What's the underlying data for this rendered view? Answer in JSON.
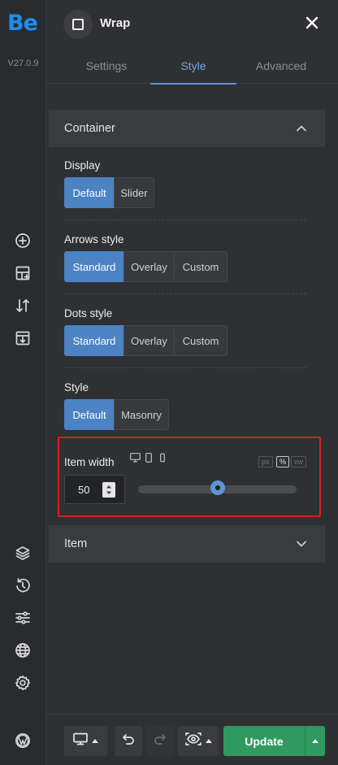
{
  "app": {
    "logo": "Be",
    "version": "V27.0.9"
  },
  "rail_icons": [
    "add-circle-icon",
    "add-section-icon",
    "sort-arrows-icon",
    "import-icon",
    "layers-icon",
    "history-icon",
    "sliders-icon",
    "globe-icon",
    "settings-icon",
    "wordpress-icon"
  ],
  "header": {
    "title": "Wrap",
    "close_icon": "close-icon"
  },
  "tabs": [
    {
      "label": "Settings",
      "active": false
    },
    {
      "label": "Style",
      "active": true
    },
    {
      "label": "Advanced",
      "active": false
    }
  ],
  "container": {
    "title": "Container",
    "expanded": true,
    "display": {
      "label": "Display",
      "options": [
        "Default",
        "Slider"
      ],
      "selected": "Default"
    },
    "arrows_style": {
      "label": "Arrows style",
      "options": [
        "Standard",
        "Overlay",
        "Custom"
      ],
      "selected": "Standard"
    },
    "dots_style": {
      "label": "Dots style",
      "options": [
        "Standard",
        "Overlay",
        "Custom"
      ],
      "selected": "Standard"
    },
    "style": {
      "label": "Style",
      "options": [
        "Default",
        "Masonry"
      ],
      "selected": "Default"
    },
    "item_width": {
      "label": "Item width",
      "value": "50",
      "units": [
        "px",
        "%",
        "vw"
      ],
      "selected_unit": "%",
      "slider_fraction": 0.5,
      "devices": [
        "desktop-icon",
        "tablet-icon",
        "mobile-icon"
      ]
    }
  },
  "item_section": {
    "title": "Item",
    "expanded": false
  },
  "footer": {
    "update_label": "Update",
    "buttons": [
      "device-preview-icon",
      "undo-icon",
      "redo-icon",
      "preview-eye-icon"
    ]
  },
  "colors": {
    "accent": "#4b83c4",
    "update": "#2e9a5f",
    "highlight": "#d81f1f"
  }
}
